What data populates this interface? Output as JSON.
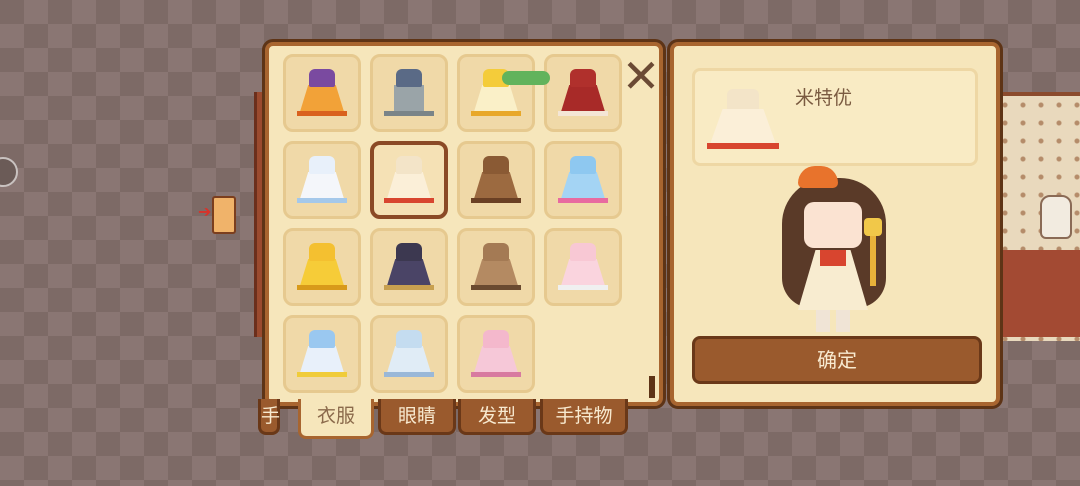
{
  "outfit_panel": {
    "close_icon": "close-x-icon",
    "badge_text": "",
    "items": [
      {
        "name": "orange-pumpkin-dress",
        "top": "#7a4aa0",
        "skirt": "#f2a238",
        "trim": "#d9611e"
      },
      {
        "name": "gray-suit",
        "top": "#5a6a86",
        "skirt": "#9aa4a8",
        "trim": "#7a8488"
      },
      {
        "name": "yellow-duck-dress",
        "top": "#f4cc3a",
        "skirt": "#faf0c8",
        "trim": "#e8a82a"
      },
      {
        "name": "red-velvet-dress",
        "top": "#b0302c",
        "skirt": "#a82a28",
        "trim": "#f4e6d6"
      },
      {
        "name": "white-blue-bow-dress",
        "top": "#e8f0fa",
        "skirt": "#f4f6fa",
        "trim": "#a4c8ea"
      },
      {
        "name": "orange-cream-dress",
        "top": "#f3e4c8",
        "skirt": "#fbefd8",
        "trim": "#d8452f",
        "selected": true
      },
      {
        "name": "brown-bear-costume",
        "top": "#8a5a34",
        "skirt": "#9c6a40",
        "trim": "#6a4024"
      },
      {
        "name": "blue-heart-dress",
        "top": "#8ec8f0",
        "skirt": "#a4d4f4",
        "trim": "#e86aa0"
      },
      {
        "name": "yellow-chick-dress",
        "top": "#f4c030",
        "skirt": "#f6cc38",
        "trim": "#d89a1a"
      },
      {
        "name": "dark-purple-dress",
        "top": "#3c3850",
        "skirt": "#4a4466",
        "trim": "#c8a050"
      },
      {
        "name": "brown-lolita-dress",
        "top": "#a47a54",
        "skirt": "#b48a62",
        "trim": "#6a4a30"
      },
      {
        "name": "pink-hoodie-outfit",
        "top": "#f8c8d4",
        "skirt": "#fad4de",
        "trim": "#f0f0f0"
      },
      {
        "name": "blue-yellow-dress",
        "top": "#9ac8f0",
        "skirt": "#e8f0fa",
        "trim": "#f0cc3a"
      },
      {
        "name": "light-blue-dress",
        "top": "#c4dcf0",
        "skirt": "#e0ecf6",
        "trim": "#9ab8d8"
      },
      {
        "name": "pink-bunny-dress",
        "top": "#f4b8cc",
        "skirt": "#f6c8d8",
        "trim": "#d87aa0"
      }
    ]
  },
  "tabs": [
    {
      "label": "手",
      "active": false
    },
    {
      "label": "衣服",
      "active": true
    },
    {
      "label": "眼睛",
      "active": false
    },
    {
      "label": "发型",
      "active": false
    },
    {
      "label": "手持物",
      "active": false
    }
  ],
  "preview": {
    "item_name": "米特优",
    "confirm_label": "确定"
  }
}
